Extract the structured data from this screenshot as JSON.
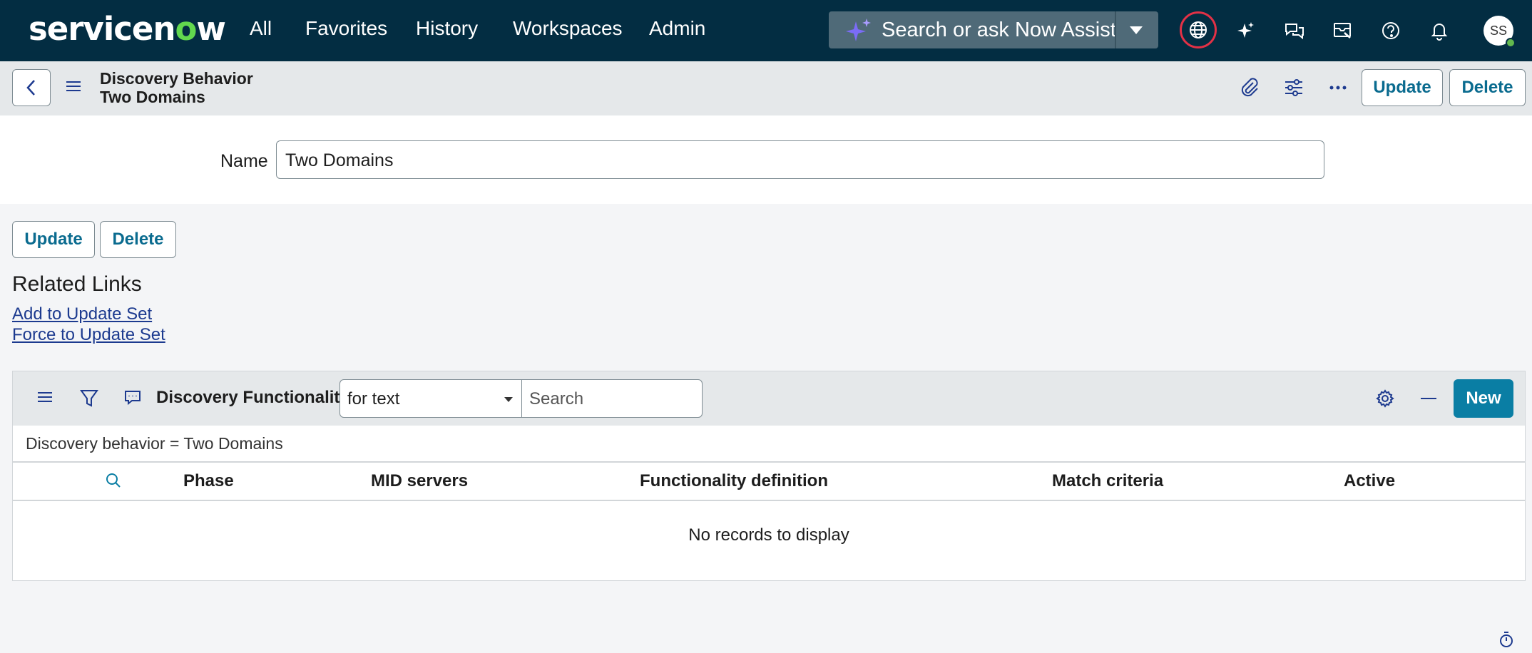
{
  "nav": {
    "logo_a": "servicen",
    "logo_o": "o",
    "logo_b": "w",
    "items": [
      "All",
      "Favorites",
      "History",
      "Workspaces",
      "Admin"
    ],
    "search_placeholder": "Search or ask Now Assist",
    "avatar_initials": "SS"
  },
  "record": {
    "title_line1": "Discovery Behavior",
    "title_line2": "Two Domains",
    "update_label": "Update",
    "delete_label": "Delete"
  },
  "form": {
    "name_label": "Name",
    "name_value": "Two Domains",
    "update_label": "Update",
    "delete_label": "Delete"
  },
  "related_links": {
    "title": "Related Links",
    "links": [
      "Add to Update Set",
      "Force to Update Set"
    ]
  },
  "related_list": {
    "title": "Discovery Functionality",
    "select_value": "for text",
    "search_placeholder": "Search",
    "new_label": "New",
    "breadcrumb": "Discovery behavior = Two Domains",
    "columns": [
      "Phase",
      "MID servers",
      "Functionality definition",
      "Match criteria",
      "Active"
    ],
    "empty_text": "No records to display"
  },
  "colors": {
    "nav_bg": "#032d42",
    "accent": "#0a7ea4",
    "link": "#1c3a8f",
    "globe_ring": "#e33146"
  }
}
